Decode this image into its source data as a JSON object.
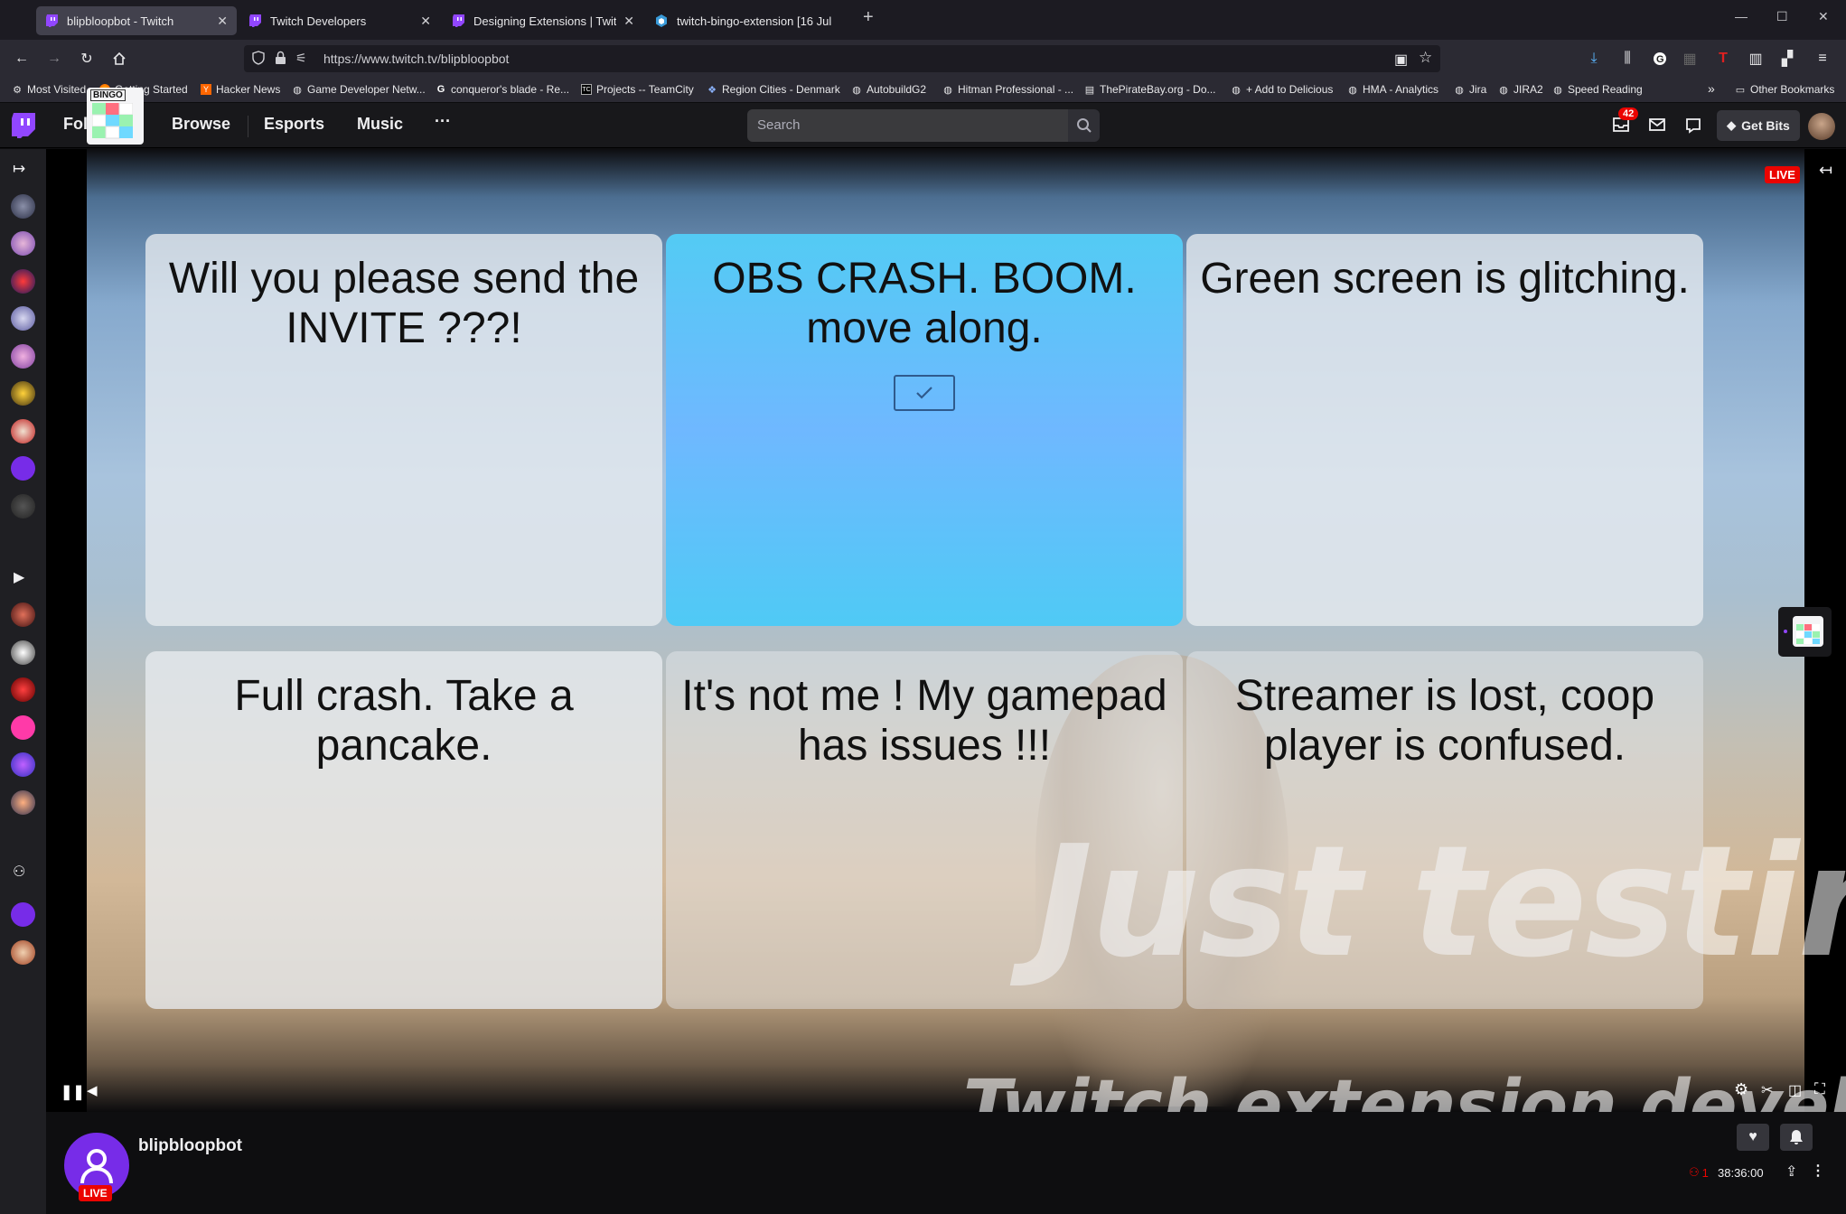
{
  "browser": {
    "tabs": [
      {
        "title": "blipbloopbot - Twitch",
        "active": true,
        "icon": "twitch-icon"
      },
      {
        "title": "Twitch Developers",
        "active": false,
        "icon": "twitch-icon"
      },
      {
        "title": "Designing Extensions | Twitch D",
        "active": false,
        "icon": "twitch-icon"
      },
      {
        "title": "twitch-bingo-extension [16 Jul",
        "active": false,
        "icon": "cube-icon"
      }
    ],
    "new_tab": "+",
    "url": "https://www.twitch.tv/blipbloopbot",
    "bookmarks": [
      {
        "label": "Most Visited",
        "icon": "gear-icon"
      },
      {
        "label": "Getting Started",
        "icon": "firefox-icon"
      },
      {
        "label": "Hacker News",
        "icon": "y-icon"
      },
      {
        "label": "Game Developer Netw...",
        "icon": "globe-icon"
      },
      {
        "label": "conqueror's blade - Re...",
        "icon": "google-icon"
      },
      {
        "label": "Projects -- TeamCity",
        "icon": "teamcity-icon"
      },
      {
        "label": "Region Cities - Denmark",
        "icon": "region-icon"
      },
      {
        "label": "AutobuildG2",
        "icon": "globe-icon"
      },
      {
        "label": "Hitman Professional - ...",
        "icon": "globe-icon"
      },
      {
        "label": "ThePirateBay.org - Do...",
        "icon": "page-icon"
      },
      {
        "label": "+ Add to Delicious",
        "icon": "globe-icon"
      },
      {
        "label": "HMA - Analytics",
        "icon": "globe-icon"
      },
      {
        "label": "Jira",
        "icon": "globe-icon"
      },
      {
        "label": "JIRA2",
        "icon": "globe-icon"
      },
      {
        "label": "Speed Reading",
        "icon": "globe-icon"
      }
    ],
    "other_bookmarks": "Other Bookmarks",
    "overflow": "»"
  },
  "twitch_nav": {
    "links": [
      "Following",
      "Browse",
      "Esports",
      "Music"
    ],
    "more": "···",
    "search_placeholder": "Search",
    "notification_count": "42",
    "get_bits": "Get Bits"
  },
  "bingo": {
    "cells": [
      {
        "text": "Will you please send the INVITE ???!",
        "checked": false
      },
      {
        "text": "OBS CRASH. BOOM. move along.",
        "checked": true
      },
      {
        "text": "Green screen is glitching.",
        "checked": false
      },
      {
        "text": "Full crash. Take a pancake.",
        "checked": false
      },
      {
        "text": "It's not me ! My gamepad has issues !!!",
        "checked": false
      },
      {
        "text": "Streamer is lost, coop player is confused.",
        "checked": false
      }
    ],
    "logo_text": "BINGO"
  },
  "video": {
    "live_badge": "LIVE",
    "watermark_line1": "Just testing",
    "watermark_line2": "Twitch extension development"
  },
  "channel": {
    "name": "blipbloopbot",
    "live_badge": "LIVE",
    "viewers": "1",
    "uptime": "38:36:00"
  },
  "colors": {
    "twitch_purple": "#9146ff",
    "live_red": "#eb0400",
    "checked_cell": "#5ac4f8"
  }
}
